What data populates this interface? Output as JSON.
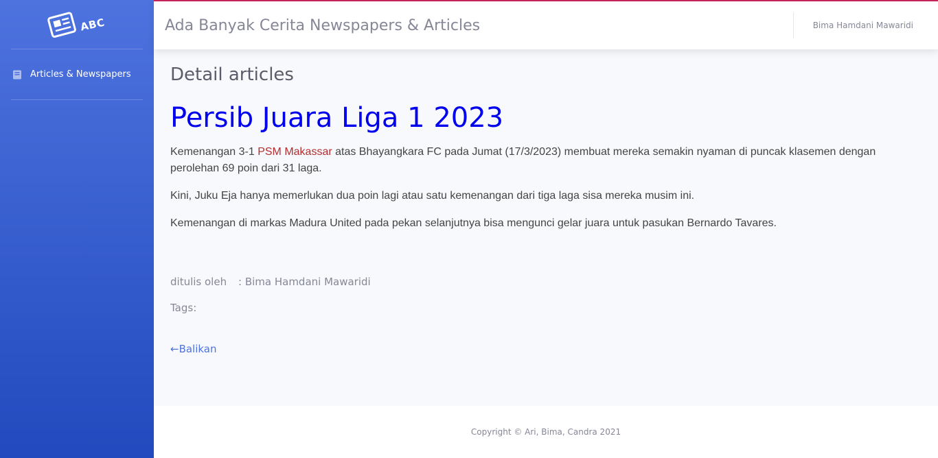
{
  "sidebar": {
    "brand": {
      "icon": "newspaper-icon",
      "text": "ABC"
    },
    "items": [
      {
        "label": "Articles & Newspapers",
        "icon": "book-icon"
      }
    ]
  },
  "topbar": {
    "title": "Ada Banyak Cerita Newspapers & Articles",
    "user": "Bima Hamdani Mawaridi",
    "accent_color": "#c3245b"
  },
  "main": {
    "page_heading": "Detail articles",
    "article": {
      "title": "Persib Juara Liga 1 2023",
      "p1_before": "Kemenangan 3-1 ",
      "p1_highlight": "PSM Makassar",
      "p1_after": " atas Bhayangkara FC pada Jumat (17/3/2023) membuat mereka semakin nyaman di puncak klasemen dengan perolehan 69 poin dari 31 laga.",
      "p2": "Kini, Juku Eja hanya memerlukan dua poin lagi atau satu kemenangan dari tiga laga sisa mereka musim ini.",
      "p3": "Kemenangan di markas Madura United pada pekan selanjutnya bisa mengunci gelar juara untuk pasukan Bernardo Tavares."
    },
    "author_label": "ditulis oleh",
    "author_value": ": Bima Hamdani Mawaridi",
    "tags_label": "Tags:",
    "back_link": "←Balikan"
  },
  "footer": {
    "copyright": "Copyright © Ari, Bima, Candra 2021"
  },
  "colors": {
    "sidebar_gradient_start": "#4e73df",
    "sidebar_gradient_end": "#224abe",
    "title_link": "#0000ee",
    "highlight": "#b32d2e"
  }
}
